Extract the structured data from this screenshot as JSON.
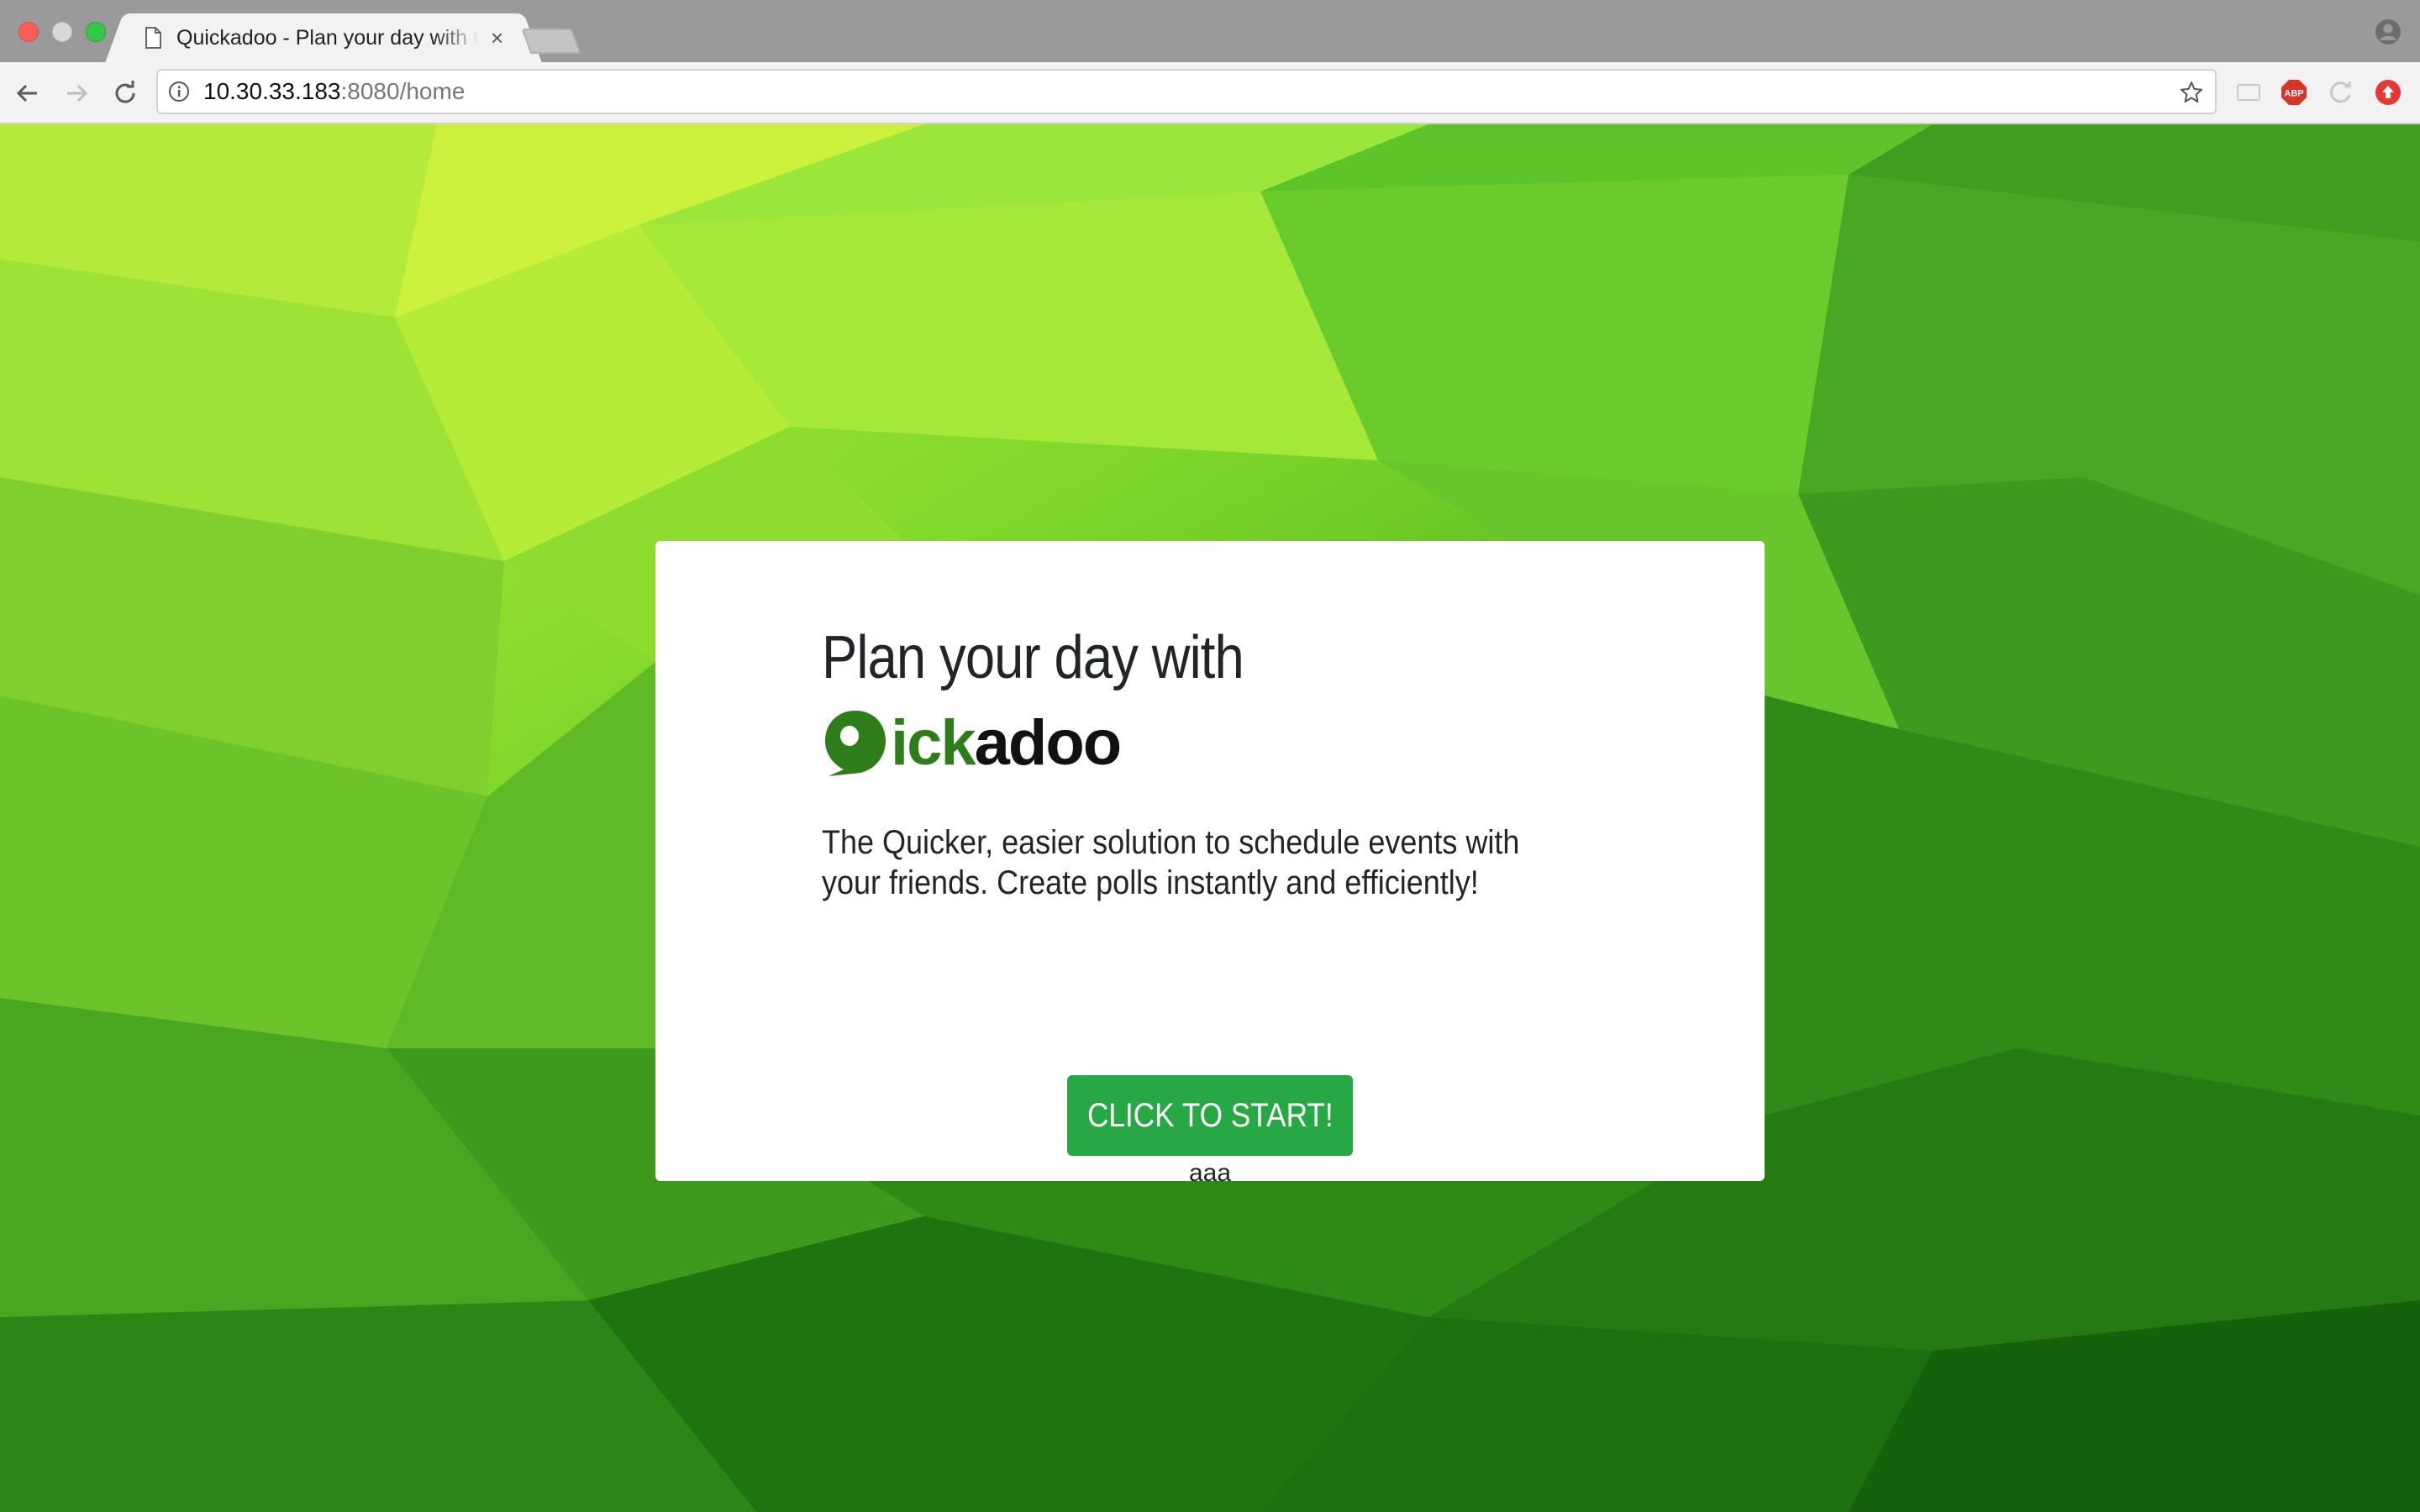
{
  "browser": {
    "tab_title": "Quickadoo - Plan your day with Quickadoo",
    "url_host": "10.30.33.183",
    "url_rest": ":8080/home",
    "extensions": [
      "cast-icon",
      "adblock-plus-icon",
      "sync-icon",
      "update-icon"
    ],
    "abp_label": "ABP"
  },
  "page": {
    "headline": "Plan your day with",
    "logo": {
      "text_green": "ick",
      "text_black": "adoo"
    },
    "description": "The Quicker, easier solution to schedule events with your friends. Create polls instantly and efficiently!",
    "cta_label": "CLICK TO START!",
    "cta_subtext": "aaa"
  },
  "colors": {
    "button": "#28a745",
    "logo_green": "#2e7d1a",
    "background_light": "#d9f53a",
    "background_dark": "#1e6e0f"
  }
}
